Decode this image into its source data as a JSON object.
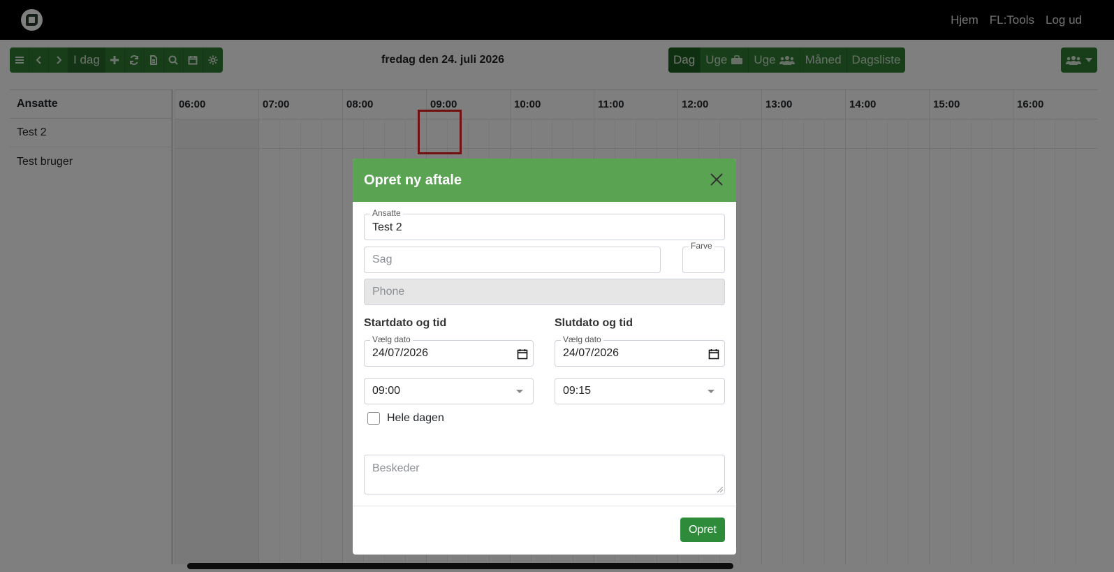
{
  "navbar": {
    "links": [
      "Hjem",
      "FL:Tools",
      "Log ud"
    ]
  },
  "toolbar": {
    "today_label": "I dag",
    "icons": [
      "menu-icon",
      "chevron-left-icon",
      "chevron-right-icon",
      "plus-icon",
      "refresh-icon",
      "document-icon",
      "search-icon",
      "calendar-icon",
      "gear-icon"
    ]
  },
  "date_title": "fredag den 24. juli 2026",
  "views": {
    "day": "Dag",
    "week_work": "Uge",
    "week_people": "Uge",
    "month": "Måned",
    "daylist": "Dagsliste"
  },
  "grid": {
    "resource_header": "Ansatte",
    "resources": [
      "Test 2",
      "Test bruger"
    ],
    "hours": [
      "06:00",
      "07:00",
      "08:00",
      "09:00",
      "10:00",
      "11:00",
      "12:00",
      "13:00",
      "14:00",
      "15:00",
      "16:00"
    ]
  },
  "modal": {
    "title": "Opret ny aftale",
    "employee": {
      "legend": "Ansatte",
      "value": "Test 2"
    },
    "case": {
      "placeholder": "Sag"
    },
    "color": {
      "legend": "Farve"
    },
    "phone": {
      "placeholder": "Phone"
    },
    "start": {
      "label": "Startdato og tid",
      "date_legend": "Vælg dato",
      "date": "24/07/2026",
      "time": "09:00"
    },
    "end": {
      "label": "Slutdato og tid",
      "date_legend": "Vælg dato",
      "date": "24/07/2026",
      "time": "09:15"
    },
    "all_day": {
      "label": "Hele dagen",
      "checked": false
    },
    "messages": {
      "placeholder": "Beskeder"
    },
    "submit": "Opret"
  },
  "colors": {
    "navbar": "#000000",
    "toolbar_green": "#2e7d32",
    "modal_header": "#5aa352",
    "submit_button": "#2e8b3a",
    "highlight": "#e02020"
  }
}
